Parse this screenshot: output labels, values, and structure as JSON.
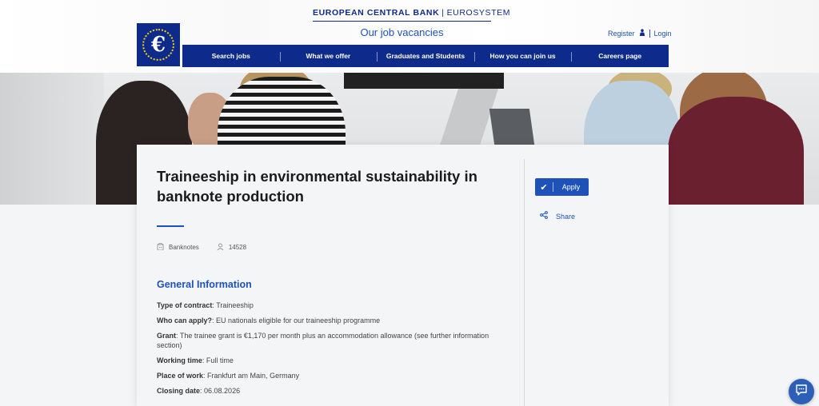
{
  "header": {
    "org_name": "EUROPEAN CENTRAL BANK",
    "org_sub": "EUROSYSTEM",
    "site_title": "Our job vacancies",
    "logo_symbol": "€",
    "register_label": "Register",
    "login_label": "Login"
  },
  "nav": {
    "items": [
      {
        "label": "Search jobs"
      },
      {
        "label": "What we offer"
      },
      {
        "label": "Graduates and Students"
      },
      {
        "label": "How you can join us"
      },
      {
        "label": "Careers page"
      }
    ]
  },
  "job": {
    "title": "Traineeship in environmental sustainability in banknote production",
    "department": "Banknotes",
    "reference": "14528",
    "section_title": "General Information",
    "details": [
      {
        "label": "Type of contract",
        "value": "Traineeship"
      },
      {
        "label": "Who can apply?",
        "value": "EU nationals eligible for our traineeship programme"
      },
      {
        "label": "Grant",
        "value": "The trainee grant is €1,170 per month plus an accommodation allowance (see further information section)"
      },
      {
        "label": "Working time",
        "value": "Full time"
      },
      {
        "label": "Place of work",
        "value": "Frankfurt am Main, Germany"
      },
      {
        "label": "Closing date",
        "value": "06.08.2026"
      }
    ]
  },
  "actions": {
    "apply_label": "Apply",
    "share_label": "Share"
  },
  "icons": {
    "user": "person-icon",
    "department": "building-icon",
    "reference": "id-card-icon",
    "apply": "checkmark-icon",
    "share": "share-icon",
    "chat": "chat-icon"
  },
  "colors": {
    "brand": "#0e2a8a",
    "accent": "#1e52b8"
  }
}
